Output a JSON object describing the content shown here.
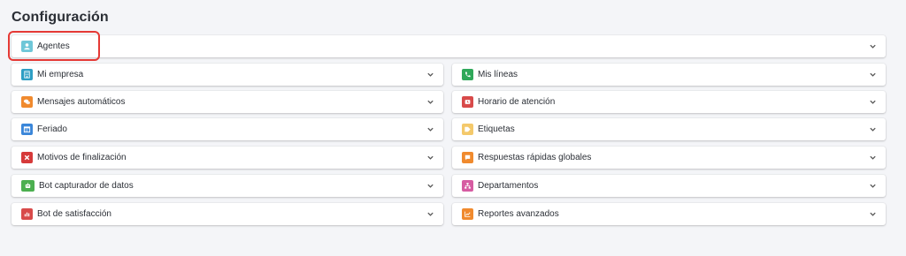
{
  "page": {
    "title": "Configuración"
  },
  "colors": {
    "agentes": "#6fc7d8",
    "mi_empresa": "#2e9ec4",
    "mis_lineas": "#2fa85a",
    "mensajes": "#f08a2e",
    "horario": "#d84a4a",
    "feriado": "#3a86d9",
    "etiquetas": "#f4c96b",
    "motivos": "#d63a3a",
    "respuestas": "#f08a2e",
    "bot_datos": "#4caf50",
    "departamentos": "#d65ca2",
    "bot_satisfaccion": "#d84a4a",
    "reportes": "#f08a2e",
    "highlight": "#e53935"
  },
  "settings": {
    "agentes": {
      "label": "Agentes",
      "icon": "user-icon"
    },
    "mi_empresa": {
      "label": "Mi empresa",
      "icon": "building-icon"
    },
    "mis_lineas": {
      "label": "Mis líneas",
      "icon": "phone-icon"
    },
    "mensajes_automaticos": {
      "label": "Mensajes automáticos",
      "icon": "chat-bubbles-icon"
    },
    "horario_atencion": {
      "label": "Horario de atención",
      "icon": "clock-icon"
    },
    "feriado": {
      "label": "Feriado",
      "icon": "calendar-icon"
    },
    "etiquetas": {
      "label": "Etiquetas",
      "icon": "tags-icon"
    },
    "motivos_finalizacion": {
      "label": "Motivos de finalización",
      "icon": "x-icon"
    },
    "respuestas_rapidas": {
      "label": "Respuestas rápidas globales",
      "icon": "speech-bubble-icon"
    },
    "bot_capturador": {
      "label": "Bot capturador de datos",
      "icon": "robot-icon"
    },
    "departamentos": {
      "label": "Departamentos",
      "icon": "sitemap-icon"
    },
    "bot_satisfaccion": {
      "label": "Bot de satisfacción",
      "icon": "bar-chart-icon"
    },
    "reportes_avanzados": {
      "label": "Reportes avanzados",
      "icon": "line-chart-icon"
    }
  }
}
